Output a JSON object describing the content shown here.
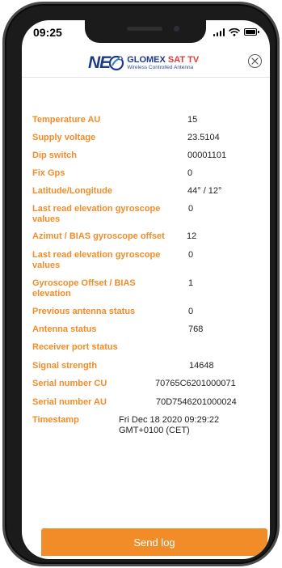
{
  "status_bar": {
    "time": "09:25"
  },
  "header": {
    "logo_neo": "NE",
    "logo_brand_main": "GLOMEX ",
    "logo_brand_accent": "SAT TV",
    "logo_subtitle": "Wireless Controlled Antenna"
  },
  "rows": [
    {
      "label": "Temperature AU",
      "value": "15"
    },
    {
      "label": "Supply voltage",
      "value": "23.5104"
    },
    {
      "label": "Dip switch",
      "value": "00001101"
    },
    {
      "label": "Fix Gps",
      "value": "0"
    },
    {
      "label": "Latitude/Longitude",
      "value": "44° / 12°"
    },
    {
      "label": "Last read elevation gyroscope values",
      "value": "0"
    },
    {
      "label": "Azimut / BIAS gyroscope offset",
      "value": "12"
    },
    {
      "label": "Last read elevation gyroscope values",
      "value": "0"
    },
    {
      "label": "Gyroscope Offset / BIAS elevation",
      "value": "1"
    },
    {
      "label": "Previous antenna status",
      "value": "0"
    },
    {
      "label": "Antenna status",
      "value": "768"
    },
    {
      "label": "Receiver port status",
      "value": ""
    },
    {
      "label": "Signal strength",
      "value": "14648"
    },
    {
      "label": "Serial number CU",
      "value": "70765C6201000071"
    },
    {
      "label": "Serial number AU",
      "value": "70D7546201000024"
    },
    {
      "label": "Timestamp",
      "value": "Fri Dec 18 2020 09:29:22 GMT+0100 (CET)"
    }
  ],
  "footer": {
    "send_label": "Send log"
  },
  "colors": {
    "accent": "#f28c28",
    "brand_blue": "#1f3a8a",
    "brand_red": "#e53935"
  },
  "icons": [
    "signal-icon",
    "wifi-icon",
    "battery-icon",
    "close-icon",
    "logo-swirl-icon"
  ]
}
